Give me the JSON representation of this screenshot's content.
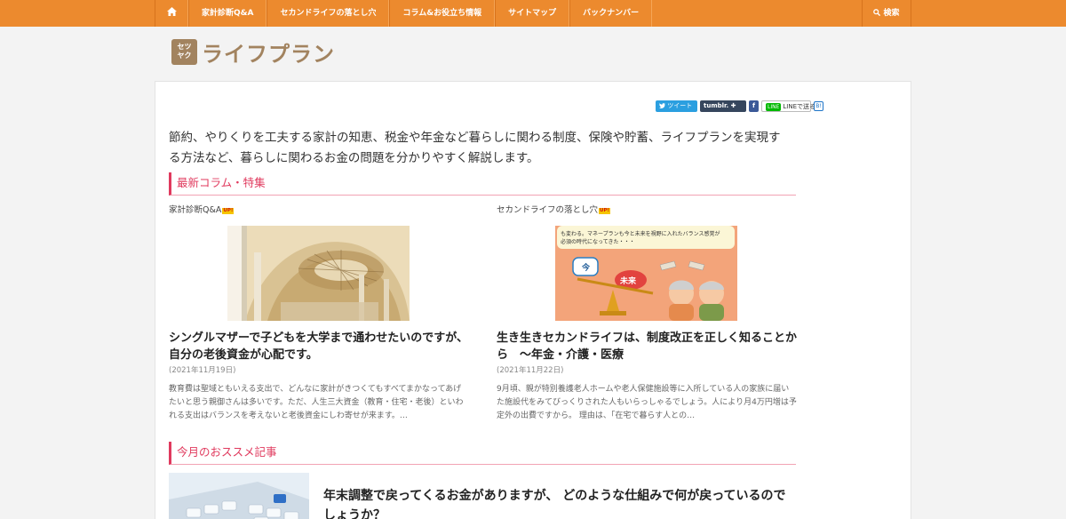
{
  "nav": {
    "home_icon": "home-icon",
    "items": [
      "家計診断Q&A",
      "セカンドライフの落とし穴",
      "コラム&お役立ち情報",
      "サイトマップ",
      "バックナンバー"
    ],
    "search_label": "検索",
    "color": "#ec8a2e"
  },
  "logo": {
    "badge_line1": "セツ",
    "badge_line2": "ヤク",
    "text": "ライフプラン"
  },
  "share": {
    "tweet": "ツイート",
    "tumblr": "tumblr.",
    "facebook": "f",
    "line": "LINEで送る",
    "line_badge": "LINE",
    "hatena": "B!"
  },
  "intro": "節約、やりくりを工夫する家計の知恵、税金や年金など暮らしに関わる制度、保険や貯蓄、ライフプランを実現する方法など、暮らしに関わるお金の問題を分かりやすく解説します。",
  "sections": {
    "latest": "最新コラム・特集",
    "recommended": "今月のおススメ記事"
  },
  "cards": [
    {
      "category": "家計診断Q&A",
      "badge": "UP!",
      "title": "シングルマザーで子どもを大学まで通わせたいのですが、自分の老後資金が心配です。",
      "date": "(2021年11月19日)",
      "excerpt": "教育費は聖域ともいえる支出で、どんなに家計がきつくてもすべてまかなってあげたいと思う親御さんは多いです。ただ、人生三大資金（教育・住宅・老後）といわれる支出はバランスを考えないと老後資金にしわ寄せが来ます。…"
    },
    {
      "category": "セカンドライフの落とし穴",
      "badge": "UP!",
      "title": "生き生きセカンドライフは、制度改正を正しく知ることから　～年金・介護・医療",
      "date": "(2021年11月22日)",
      "excerpt": "9月頃、親が特別養護老人ホームや老人保健施設等に入所している人の家族に届いた施設代をみてびっくりされた人もいらっしゃるでしょう。人により月4万円増は予定外の出費ですから。 理由は、「在宅で暮らす人との…",
      "image_text_1": "も変わる。マネープランも今と未来を視野に入れたバランス感覚が",
      "image_text_2": "必須の時代になってきた・・・",
      "image_label_now": "今",
      "image_label_future": "未来"
    }
  ],
  "recommended": {
    "title": "年末調整で戻ってくるお金がありますが、 どのような仕組みで何が戻っているのでしょうか？"
  }
}
